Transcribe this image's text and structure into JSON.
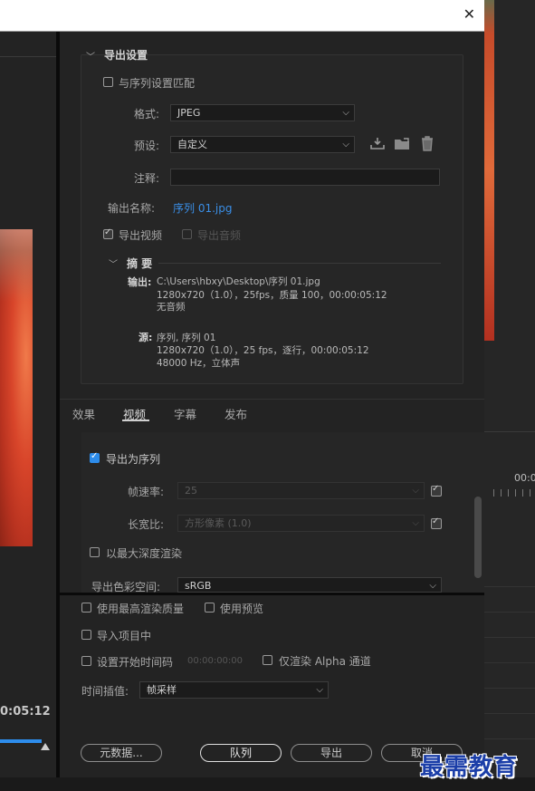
{
  "window": {
    "close_glyph": "✕"
  },
  "left_preview": {
    "timecode": "0:05:12"
  },
  "right_panel": {
    "timecode": "00:0"
  },
  "export_settings": {
    "section_title": "导出设置",
    "match_sequence_label": "与序列设置匹配",
    "match_sequence_checked": false,
    "format_label": "格式:",
    "format_value": "JPEG",
    "preset_label": "预设:",
    "preset_value": "自定义",
    "comments_label": "注释:",
    "comments_value": "",
    "output_name_label": "输出名称:",
    "output_name_value": "序列 01.jpg",
    "export_video_label": "导出视频",
    "export_video_checked": true,
    "export_audio_label": "导出音频",
    "export_audio_checked": false,
    "summary_title": "摘 要",
    "output_label": "输出:",
    "output_path": "C:\\Users\\hbxy\\Desktop\\序列 01.jpg",
    "output_line2": "1280x720（1.0），25fps，质量 100，00:00:05:12",
    "output_line3": "无音频",
    "source_label": "源:",
    "source_line1": "序列, 序列 01",
    "source_line2": "1280x720（1.0），25 fps，逐行，00:00:05:12",
    "source_line3": "48000 Hz，立体声"
  },
  "tabs": [
    {
      "label": "效果",
      "active": false
    },
    {
      "label": "视频",
      "active": true
    },
    {
      "label": "字幕",
      "active": false
    },
    {
      "label": "发布",
      "active": false
    }
  ],
  "video_tab": {
    "export_as_sequence_label": "导出为序列",
    "export_as_sequence_checked": true,
    "frame_rate_label": "帧速率:",
    "frame_rate_value": "25",
    "frame_rate_checked": true,
    "aspect_label": "长宽比:",
    "aspect_value": "方形像素 (1.0)",
    "aspect_checked": true,
    "max_depth_label": "以最大深度渲染",
    "max_depth_checked": false,
    "color_space_label": "导出色彩空间:",
    "color_space_value": "sRGB"
  },
  "bottom": {
    "max_quality_label": "使用最高渲染质量",
    "use_preview_label": "使用预览",
    "import_project_label": "导入项目中",
    "set_start_tc_label": "设置开始时间码",
    "start_tc_value": "00:00:00:00",
    "render_alpha_label": "仅渲染 Alpha 通道",
    "interp_label": "时间插值:",
    "interp_value": "帧采样"
  },
  "buttons": {
    "metadata": "元数据...",
    "queue": "队列",
    "export": "导出",
    "cancel": "取消"
  },
  "watermark": "最需教育"
}
